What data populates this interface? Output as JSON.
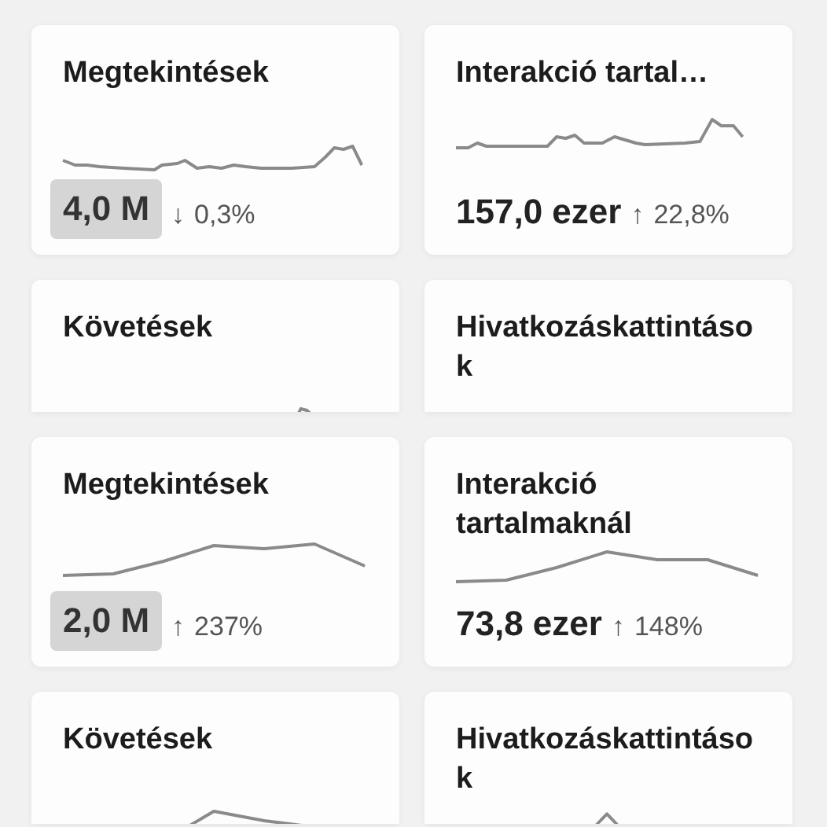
{
  "sections": [
    {
      "kind": "full",
      "cards": [
        {
          "title": "Megtekintések",
          "value": "4,0 M",
          "selected": true,
          "arrow": "↓",
          "change": "0,3%"
        },
        {
          "title": "Interakció tartal…",
          "value": "157,0 ezer",
          "selected": false,
          "arrow": "↑",
          "change": "22,8%"
        }
      ]
    },
    {
      "kind": "cropped",
      "cards": [
        {
          "title": "Követések"
        },
        {
          "title": "Hivatkozáskattintások"
        }
      ]
    },
    {
      "kind": "full",
      "cards": [
        {
          "title": "Megtekintések",
          "value": "2,0 M",
          "selected": true,
          "arrow": "↑",
          "change": "237%"
        },
        {
          "title": "Interakció tartalmaknál",
          "value": "73,8 ezer",
          "selected": false,
          "arrow": "↑",
          "change": "148%"
        }
      ]
    },
    {
      "kind": "cropped",
      "cards": [
        {
          "title": "Követések"
        },
        {
          "title": "Hivatkozáskattintások"
        }
      ]
    }
  ]
}
